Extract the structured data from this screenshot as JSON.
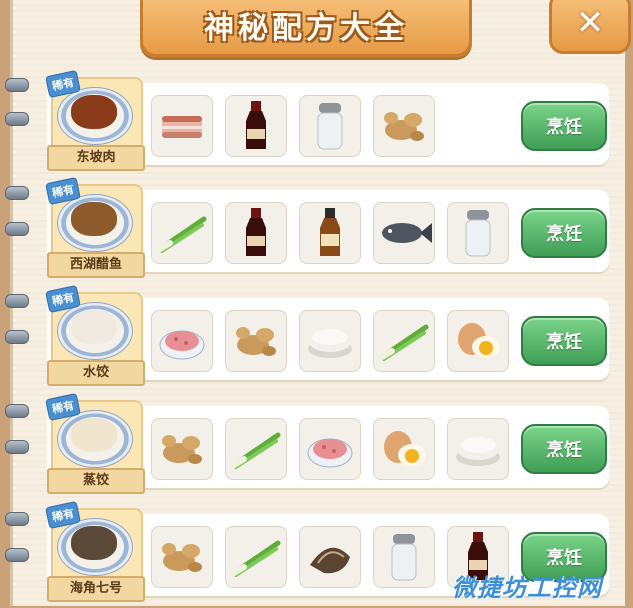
{
  "title": "神秘配方大全",
  "close_label": "✕",
  "badge_label": "稀有",
  "cook_label": "烹饪",
  "watermark": "微捷坊工控网",
  "recipes": [
    {
      "name": "东坡肉",
      "food_color": "#8a3b1a",
      "ingredients": [
        "pork-belly-icon",
        "soy-sauce-icon",
        "salt-shaker-icon",
        "ginger-icon"
      ]
    },
    {
      "name": "西湖醋鱼",
      "food_color": "#8c5a2b",
      "ingredients": [
        "scallion-icon",
        "soy-sauce-icon",
        "vinegar-bottle-icon",
        "fish-icon",
        "salt-shaker-icon"
      ]
    },
    {
      "name": "水饺",
      "food_color": "#efe9df",
      "ingredients": [
        "minced-meat-icon",
        "ginger-icon",
        "flour-dough-icon",
        "scallion-icon",
        "egg-icon"
      ]
    },
    {
      "name": "蒸饺",
      "food_color": "#f0e6cf",
      "ingredients": [
        "ginger-icon",
        "scallion-icon",
        "minced-meat-icon",
        "egg-icon",
        "flour-dough-icon"
      ]
    },
    {
      "name": "海角七号",
      "food_color": "#5b4a3a",
      "ingredients": [
        "ginger-icon",
        "scallion-icon",
        "conch-shell-icon",
        "salt-shaker-icon",
        "soy-sauce-icon"
      ]
    }
  ]
}
